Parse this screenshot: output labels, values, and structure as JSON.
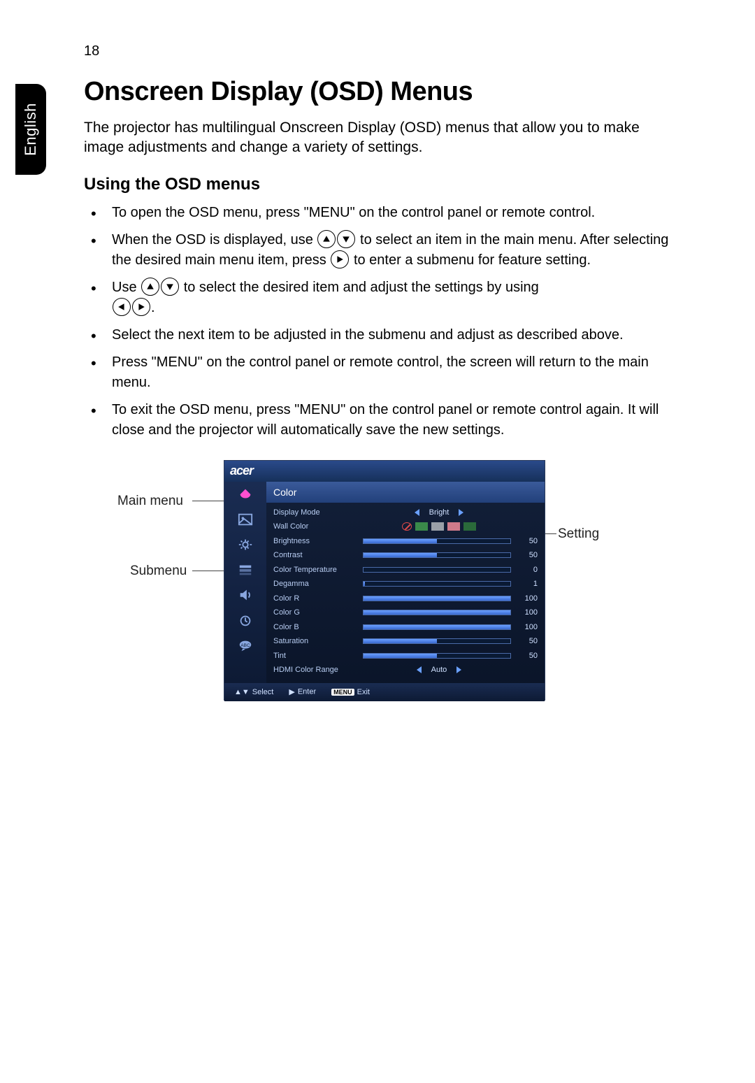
{
  "page_number": "18",
  "language_tab": "English",
  "heading": "Onscreen Display (OSD) Menus",
  "intro": "The projector has multilingual Onscreen Display (OSD) menus that allow you to make image adjustments and change a variety of settings.",
  "subheading": "Using the OSD menus",
  "bullets": {
    "b1": "To open the OSD menu, press \"MENU\" on the control panel or remote control.",
    "b2a": "When the OSD is displayed, use ",
    "b2b": " to select an item in the main menu. After selecting the desired main menu item, press ",
    "b2c": " to enter a submenu for feature setting.",
    "b3a": "Use ",
    "b3b": " to select the desired item and adjust the settings by using ",
    "b3c": ".",
    "b4": "Select the next item to be adjusted in the submenu and adjust as described above.",
    "b5": "Press \"MENU\" on the control panel or remote control, the screen will return to the main menu.",
    "b6": "To exit the OSD menu, press \"MENU\" on the control panel or remote control again. It will close and the projector will automatically save the new settings."
  },
  "callouts": {
    "main_menu": "Main menu",
    "submenu": "Submenu",
    "setting": "Setting"
  },
  "osd": {
    "brand": "acer",
    "title": "Color",
    "rows": [
      {
        "label": "Display Mode",
        "type": "option",
        "value": "Bright"
      },
      {
        "label": "Wall Color",
        "type": "swatch"
      },
      {
        "label": "Brightness",
        "type": "slider",
        "value": 50,
        "max": 100
      },
      {
        "label": "Contrast",
        "type": "slider",
        "value": 50,
        "max": 100
      },
      {
        "label": "Color Temperature",
        "type": "slider",
        "value": 0,
        "max": 100
      },
      {
        "label": "Degamma",
        "type": "slider",
        "value": 1,
        "max": 100
      },
      {
        "label": "Color R",
        "type": "slider",
        "value": 100,
        "max": 100
      },
      {
        "label": "Color G",
        "type": "slider",
        "value": 100,
        "max": 100
      },
      {
        "label": "Color B",
        "type": "slider",
        "value": 100,
        "max": 100
      },
      {
        "label": "Saturation",
        "type": "slider",
        "value": 50,
        "max": 100
      },
      {
        "label": "Tint",
        "type": "slider",
        "value": 50,
        "max": 100
      },
      {
        "label": "HDMI Color Range",
        "type": "option",
        "value": "Auto"
      }
    ],
    "swatch_colors": [
      "#3a8a4a",
      "#9aa0a8",
      "#d07a8a",
      "#2a6a3a"
    ],
    "footer": {
      "select": "Select",
      "enter": "Enter",
      "menu": "MENU",
      "exit": "Exit"
    }
  }
}
